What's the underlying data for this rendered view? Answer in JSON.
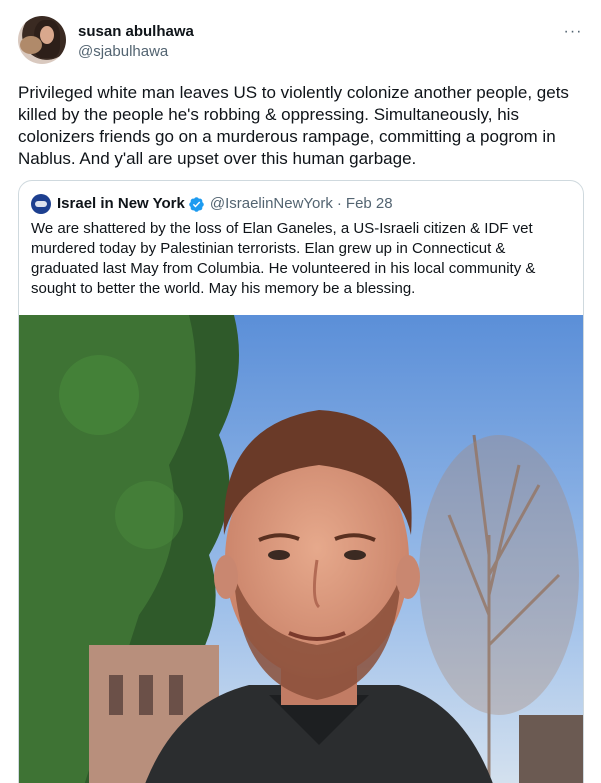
{
  "author": {
    "display_name": "susan abulhawa",
    "handle": "@sjabulhawa",
    "avatar_icon": "profile-photo"
  },
  "menu": {
    "icon": "more-horizontal-icon",
    "label": "···"
  },
  "tweet": {
    "text": "Privileged white man leaves US to violently colonize another people, gets killed by the people he's robbing & oppressing. Simultaneously, his colonizers friends go on a murderous rampage, committing a pogrom in Nablus. And y'all are upset over this human garbage."
  },
  "quoted": {
    "display_name": "Israel in New York",
    "handle": "@IsraelinNewYork",
    "separator": "·",
    "date": "Feb 28",
    "text": "We are shattered by the loss of Elan Ganeles, a US-Israeli citizen & IDF vet murdered today by Palestinian terrorists. Elan grew up in Connecticut & graduated last May from Columbia. He volunteered in his local community & sought to better the world. May his memory be a blessing.",
    "verified_color": "#1d9bf0"
  },
  "colors": {
    "text": "#0f1419",
    "secondary": "#536471",
    "border": "#cfd9de"
  }
}
